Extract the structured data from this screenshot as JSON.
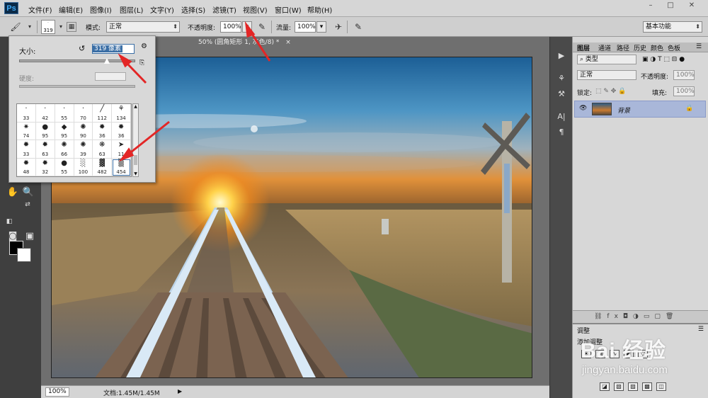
{
  "app": {
    "logo": "Ps"
  },
  "menu": [
    "文件(F)",
    "编辑(E)",
    "图像(I)",
    "图层(L)",
    "文字(Y)",
    "选择(S)",
    "滤镜(T)",
    "视图(V)",
    "窗口(W)",
    "帮助(H)"
  ],
  "window_controls": {
    "minimize": "–",
    "restore": "□",
    "close": "✕"
  },
  "options": {
    "brush_size": "319",
    "mode_label": "模式:",
    "mode_value": "正常",
    "opacity_label": "不透明度:",
    "opacity_value": "100%",
    "flow_label": "流量:",
    "flow_value": "100%",
    "workspace": "基本功能"
  },
  "brush_popup": {
    "size_label": "大小:",
    "size_value": "319 像素",
    "hardness_label": "硬度:",
    "presets": [
      "33",
      "42",
      "55",
      "70",
      "112",
      "134",
      "74",
      "95",
      "95",
      "90",
      "36",
      "36",
      "33",
      "63",
      "66",
      "39",
      "63",
      "11",
      "48",
      "32",
      "55",
      "100",
      "482",
      "454"
    ],
    "selected_index": 23
  },
  "document": {
    "tab_title": "50% (圆角矩形 1, 灰色/8) *",
    "tab_close": "×",
    "zoom": "100%",
    "doc_info": "文档:1.45M/1.45M"
  },
  "layers_panel": {
    "tabs": [
      "图层",
      "通道",
      "路径",
      "历史",
      "颜色",
      "色板"
    ],
    "filter_type": "类型",
    "blend_mode": "正常",
    "opacity_label": "不透明度:",
    "opacity_value": "100%",
    "lock_label": "锁定:",
    "fill_label": "填充:",
    "fill_value": "100%",
    "layer_name": "背景"
  },
  "adjustments_panel": {
    "tab": "调整",
    "subtitle": "添加调整"
  },
  "watermark": {
    "brand": "Bai 经验",
    "url": "jingyan.baidu.com"
  }
}
